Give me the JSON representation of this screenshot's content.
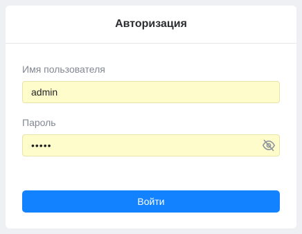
{
  "form": {
    "title": "Авторизация",
    "username_label": "Имя пользователя",
    "username_value": "admin",
    "password_label": "Пароль",
    "password_value": "•••••",
    "password_toggle_icon": "eye-slash-icon",
    "submit_label": "Войти"
  },
  "colors": {
    "background": "#eff0f3",
    "card": "#ffffff",
    "input_fill": "#fffccc",
    "primary": "#1382ff",
    "label": "#808792",
    "title": "#2b2d31"
  }
}
